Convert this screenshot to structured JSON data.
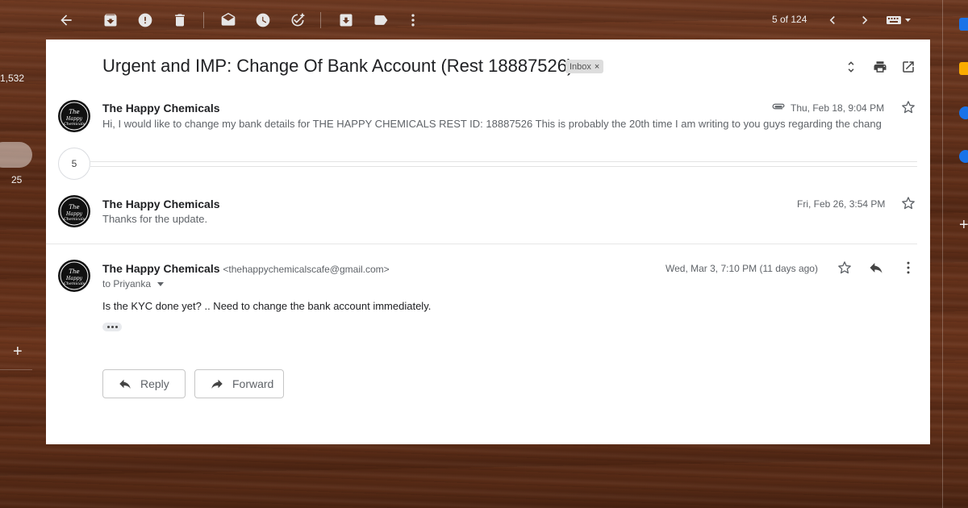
{
  "toolbar": {
    "icons": [
      "back-arrow-icon",
      "archive-icon",
      "report-spam-icon",
      "delete-icon",
      "mark-unread-icon",
      "snooze-icon",
      "add-task-icon",
      "move-to-icon",
      "label-icon",
      "more-vert-icon"
    ],
    "pagination": "5 of 124"
  },
  "sidebar": {
    "count_a": "1,532",
    "count_b": "25"
  },
  "thread": {
    "subject": "Urgent and IMP: Change Of Bank Account (Rest 18887526)",
    "label": "Inbox",
    "label_remove": "×",
    "collapsed_count": "5",
    "messages": [
      {
        "sender": "The Happy Chemicals",
        "date": "Thu, Feb 18, 9:04 PM",
        "has_attachment": true,
        "snippet": "Hi, I would like to change my bank details for THE HAPPY CHEMICALS REST ID: 18887526 This is probably the 20th time I am writing to you guys regarding the chang"
      },
      {
        "sender": "The Happy Chemicals",
        "date": "Fri, Feb 26, 3:54 PM",
        "snippet": "Thanks for the update."
      },
      {
        "sender": "The Happy Chemicals",
        "email": "<thehappychemicalscafe@gmail.com>",
        "date": "Wed, Mar 3, 7:10 PM (11 days ago)",
        "to": "to Priyanka",
        "body": "Is the KYC done yet? .. Need to change the bank account immediately."
      }
    ]
  },
  "actions": {
    "reply": "Reply",
    "forward": "Forward"
  },
  "colors": {
    "card_bg": "#ffffff",
    "text_primary": "#202124",
    "text_secondary": "#5f6368",
    "chip_bg": "#dddddd"
  }
}
